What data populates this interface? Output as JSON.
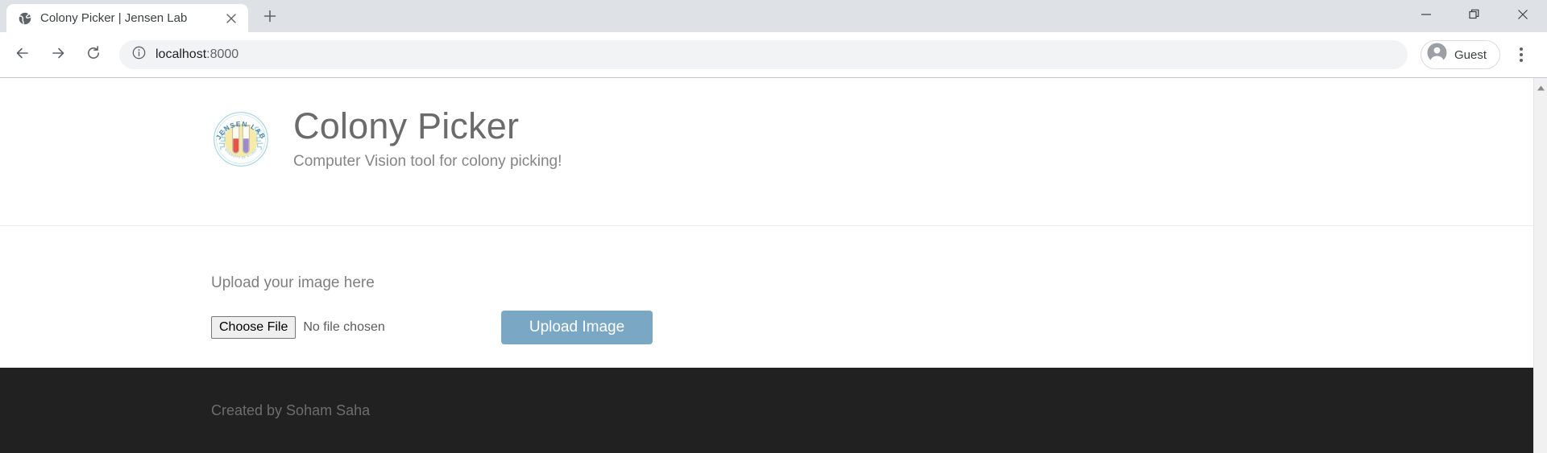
{
  "browser": {
    "tab": {
      "title": "Colony Picker | Jensen Lab",
      "favicon_icon": "globe-icon",
      "close_icon": "close-icon"
    },
    "new_tab_icon": "plus-icon",
    "window_controls": {
      "minimize_icon": "minimize-icon",
      "restore_icon": "restore-icon",
      "close_icon": "close-icon"
    },
    "toolbar": {
      "back_icon": "arrow-left-icon",
      "forward_icon": "arrow-right-icon",
      "reload_icon": "reload-icon",
      "site_info_icon": "info-circle-icon",
      "url_host": "localhost",
      "url_port": ":8000",
      "profile_name": "Guest",
      "profile_icon": "account-circle-icon",
      "menu_icon": "three-dot-menu-icon"
    },
    "scrollbar": {
      "up_arrow_icon": "scroll-up-arrow-icon"
    }
  },
  "page": {
    "header": {
      "logo_icon": "jensen-lab-logo",
      "logo_text_top": "JENSEN LAB",
      "logo_text_bottom": "UNIVERSITY OF ILLINOIS",
      "title": "Colony Picker",
      "subtitle": "Computer Vision tool for colony picking!"
    },
    "upload": {
      "label": "Upload your image here",
      "choose_file_label": "Choose File",
      "no_file_text": "No file chosen",
      "submit_label": "Upload Image"
    },
    "footer": {
      "credit": "Created by Soham Saha"
    }
  },
  "colors": {
    "accent_button": "#7aa8c4",
    "footer_bg": "#212121",
    "title_text": "#6b6b6b",
    "logo_ring": "#a8d4e0",
    "logo_disc": "#f7e9a8",
    "tube_red": "#e2564a",
    "tube_purple": "#9c8bc8"
  }
}
